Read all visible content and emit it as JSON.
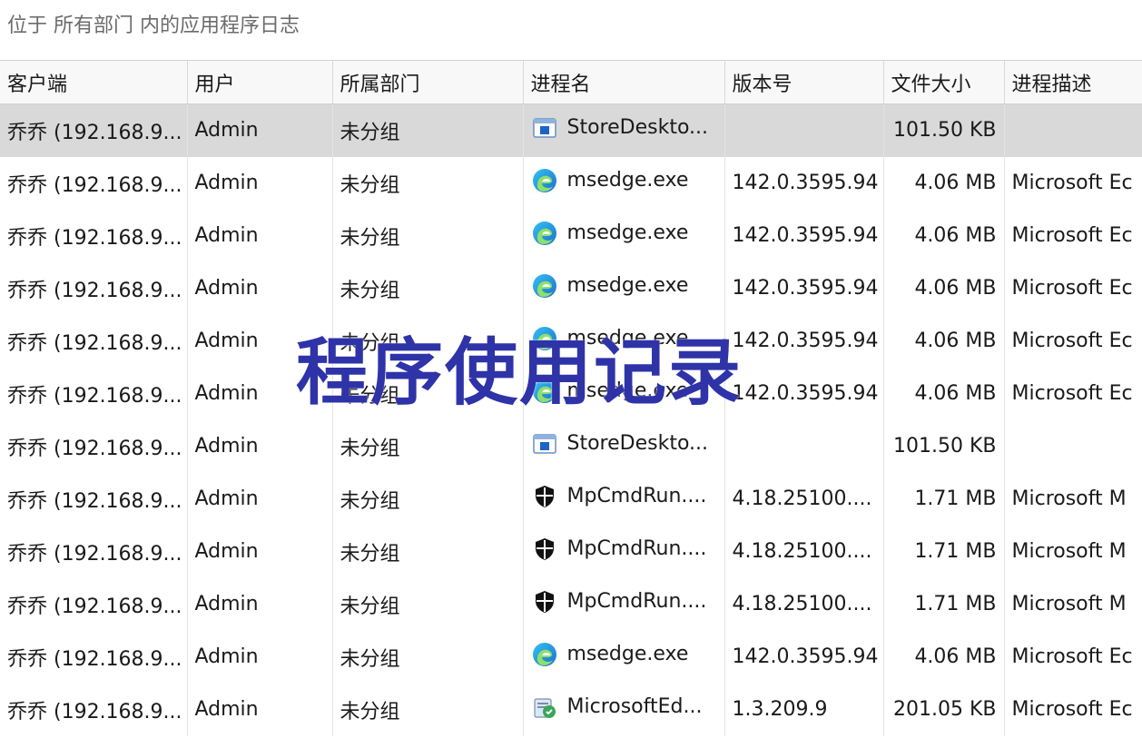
{
  "caption": "位于 所有部门 内的应用程序日志",
  "watermark": "程序使用记录",
  "columns": [
    "客户端",
    "用户",
    "所属部门",
    "进程名",
    "版本号",
    "文件大小",
    "进程描述"
  ],
  "rows": [
    {
      "client": "乔乔 (192.168.9...",
      "user": "Admin",
      "dept": "未分组",
      "icon": "store-desktop-icon",
      "process": "StoreDeskto...",
      "version": "",
      "size": "101.50 KB",
      "desc": "",
      "selected": true
    },
    {
      "client": "乔乔 (192.168.9...",
      "user": "Admin",
      "dept": "未分组",
      "icon": "edge-icon",
      "process": "msedge.exe",
      "version": "142.0.3595.94",
      "size": "4.06 MB",
      "desc": "Microsoft Ec"
    },
    {
      "client": "乔乔 (192.168.9...",
      "user": "Admin",
      "dept": "未分组",
      "icon": "edge-icon",
      "process": "msedge.exe",
      "version": "142.0.3595.94",
      "size": "4.06 MB",
      "desc": "Microsoft Ec"
    },
    {
      "client": "乔乔 (192.168.9...",
      "user": "Admin",
      "dept": "未分组",
      "icon": "edge-icon",
      "process": "msedge.exe",
      "version": "142.0.3595.94",
      "size": "4.06 MB",
      "desc": "Microsoft Ec"
    },
    {
      "client": "乔乔 (192.168.9...",
      "user": "Admin",
      "dept": "未分组",
      "icon": "edge-icon",
      "process": "msedge.exe",
      "version": "142.0.3595.94",
      "size": "4.06 MB",
      "desc": "Microsoft Ec"
    },
    {
      "client": "乔乔 (192.168.9...",
      "user": "Admin",
      "dept": "未分组",
      "icon": "edge-icon",
      "process": "msedge.exe",
      "version": "142.0.3595.94",
      "size": "4.06 MB",
      "desc": "Microsoft Ec"
    },
    {
      "client": "乔乔 (192.168.9...",
      "user": "Admin",
      "dept": "未分组",
      "icon": "store-desktop-icon",
      "process": "StoreDeskto...",
      "version": "",
      "size": "101.50 KB",
      "desc": ""
    },
    {
      "client": "乔乔 (192.168.9...",
      "user": "Admin",
      "dept": "未分组",
      "icon": "defender-shield-icon",
      "process": "MpCmdRun....",
      "version": "4.18.25100....",
      "size": "1.71 MB",
      "desc": "Microsoft M"
    },
    {
      "client": "乔乔 (192.168.9...",
      "user": "Admin",
      "dept": "未分组",
      "icon": "defender-shield-icon",
      "process": "MpCmdRun....",
      "version": "4.18.25100....",
      "size": "1.71 MB",
      "desc": "Microsoft M"
    },
    {
      "client": "乔乔 (192.168.9...",
      "user": "Admin",
      "dept": "未分组",
      "icon": "defender-shield-icon",
      "process": "MpCmdRun....",
      "version": "4.18.25100....",
      "size": "1.71 MB",
      "desc": "Microsoft M"
    },
    {
      "client": "乔乔 (192.168.9...",
      "user": "Admin",
      "dept": "未分组",
      "icon": "edge-icon",
      "process": "msedge.exe",
      "version": "142.0.3595.94",
      "size": "4.06 MB",
      "desc": "Microsoft Ec"
    },
    {
      "client": "乔乔 (192.168.9...",
      "user": "Admin",
      "dept": "未分组",
      "icon": "edge-updater-icon",
      "process": "MicrosoftEd...",
      "version": "1.3.209.9",
      "size": "201.05 KB",
      "desc": "Microsoft Ec"
    }
  ]
}
